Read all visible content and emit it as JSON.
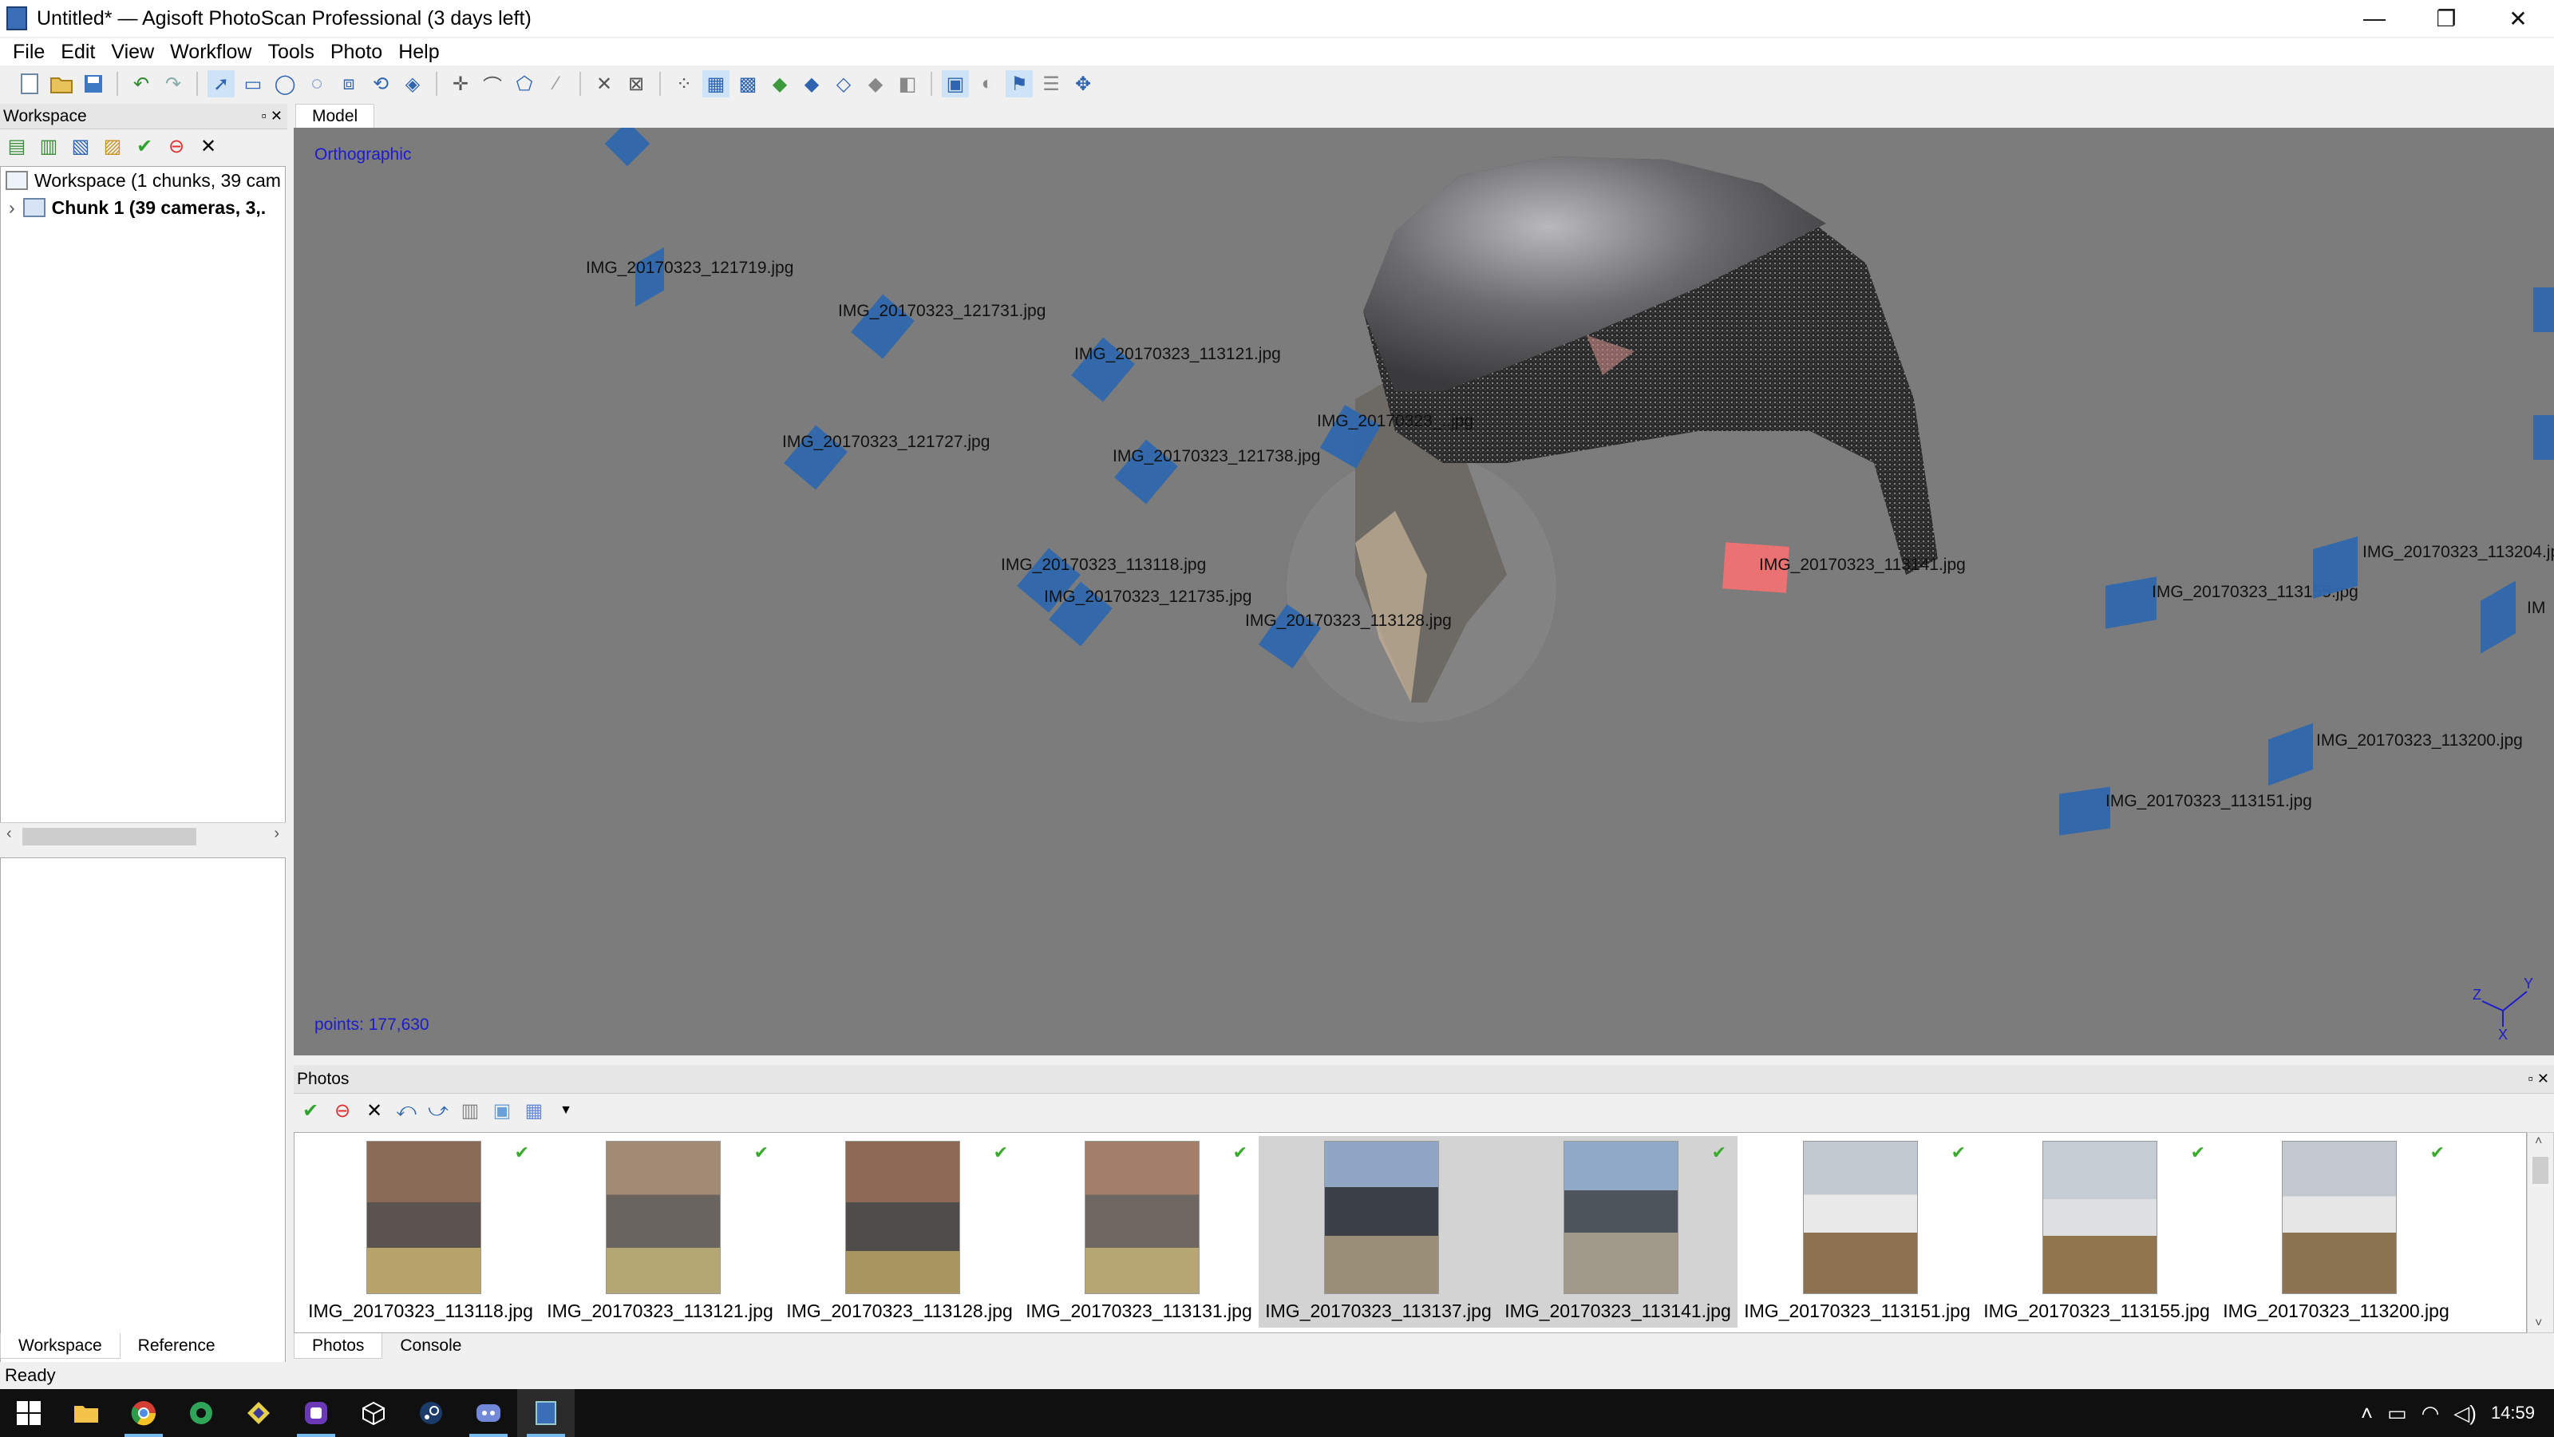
{
  "window": {
    "title": "Untitled* — Agisoft PhotoScan Professional (3 days left)",
    "minimize_glyph": "—",
    "restore_glyph": "❐",
    "close_glyph": "✕"
  },
  "menu": [
    "File",
    "Edit",
    "View",
    "Workflow",
    "Tools",
    "Photo",
    "Help"
  ],
  "workspace": {
    "title": "Workspace",
    "root_label": "Workspace (1 chunks, 39 cam",
    "chunk_label": "Chunk 1 (39 cameras, 3,.",
    "tabs": [
      "Workspace",
      "Reference"
    ]
  },
  "model": {
    "tab": "Model",
    "projection": "Orthographic",
    "points": "points: 177,630",
    "cameras": [
      {
        "label": "IMG_20170323_121719.jpg"
      },
      {
        "label": "IMG_20170323_121731.jpg"
      },
      {
        "label": "IMG_20170323_113121.jpg"
      },
      {
        "label": "IMG_20170323_121727.jpg"
      },
      {
        "label": "IMG_20170323_121738.jpg"
      },
      {
        "label": "IMG_20170323_113118.jpg"
      },
      {
        "label": "IMG_20170323_121735.jpg"
      },
      {
        "label": "IMG_20170323_113128.jpg"
      },
      {
        "label": "IMG_20170323_113141.jpg"
      },
      {
        "label": "IMG_20170323_113155.jpg"
      },
      {
        "label": "IMG_20170323_113204.jp"
      },
      {
        "label": "IMG_20170323_113200.jpg"
      },
      {
        "label": "IMG_20170323_113151.jpg"
      },
      {
        "label": "IMG_20170323_..jpg"
      },
      {
        "label": "IM"
      }
    ],
    "axes": {
      "x": "X",
      "y": "Y",
      "z": "Z"
    }
  },
  "photos": {
    "title": "Photos",
    "items": [
      {
        "name": "IMG_20170323_113118.jpg",
        "aligned": true
      },
      {
        "name": "IMG_20170323_113121.jpg",
        "aligned": true
      },
      {
        "name": "IMG_20170323_113128.jpg",
        "aligned": true
      },
      {
        "name": "IMG_20170323_113131.jpg",
        "aligned": true
      },
      {
        "name": "IMG_20170323_113137.jpg",
        "aligned": false
      },
      {
        "name": "IMG_20170323_113141.jpg",
        "aligned": true
      },
      {
        "name": "IMG_20170323_113151.jpg",
        "aligned": true
      },
      {
        "name": "IMG_20170323_113155.jpg",
        "aligned": true
      },
      {
        "name": "IMG_20170323_113200.jpg",
        "aligned": true
      }
    ],
    "tabs": [
      "Photos",
      "Console"
    ]
  },
  "status": "Ready",
  "taskbar": {
    "clock": "14:59",
    "apps": [
      "start-icon",
      "file-explorer-icon",
      "chrome-icon",
      "app-icon-green",
      "app-icon-diamond",
      "app-icon-purple",
      "app-icon-cube",
      "steam-icon",
      "discord-icon",
      "photoscan-icon"
    ]
  },
  "colors": {
    "viewport_bg": "#7c7c7c",
    "camera_blue": "#2f68ad",
    "camera_selected": "#f07272",
    "label_blue": "#1c1ccc"
  }
}
